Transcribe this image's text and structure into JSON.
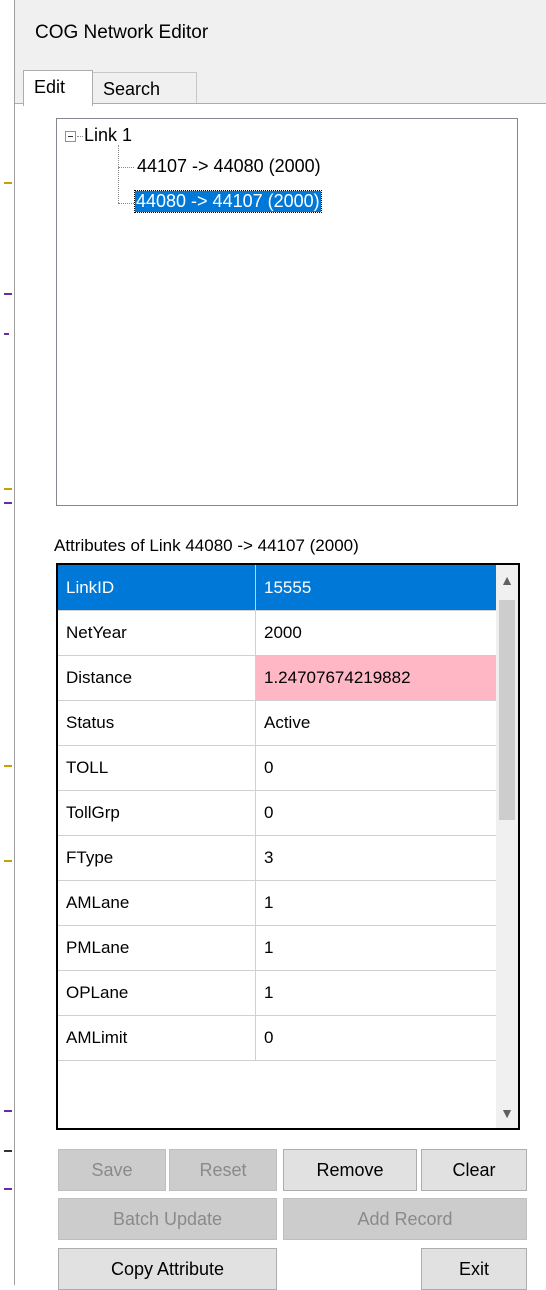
{
  "window": {
    "title": "COG Network Editor"
  },
  "tabs": [
    {
      "label": "Edit"
    },
    {
      "label": "Search"
    }
  ],
  "tree": {
    "root": {
      "label": "Link 1"
    },
    "children": [
      {
        "label": "44107 -> 44080 (2000)"
      },
      {
        "label": "44080 -> 44107 (2000)"
      }
    ]
  },
  "attributes": {
    "caption": "Attributes of Link 44080 -> 44107 (2000)",
    "rows": [
      {
        "name": "LinkID",
        "value": "15555"
      },
      {
        "name": "NetYear",
        "value": "2000"
      },
      {
        "name": "Distance",
        "value": "1.24707674219882"
      },
      {
        "name": "Status",
        "value": "Active"
      },
      {
        "name": "TOLL",
        "value": "0"
      },
      {
        "name": "TollGrp",
        "value": "0"
      },
      {
        "name": "FType",
        "value": "3"
      },
      {
        "name": "AMLane",
        "value": "1"
      },
      {
        "name": "PMLane",
        "value": "1"
      },
      {
        "name": "OPLane",
        "value": "1"
      },
      {
        "name": "AMLimit",
        "value": "0"
      }
    ]
  },
  "buttons": {
    "save": "Save",
    "reset": "Reset",
    "remove": "Remove",
    "clear": "Clear",
    "batch_update": "Batch Update",
    "add_record": "Add Record",
    "copy_attribute": "Copy Attribute",
    "exit": "Exit"
  },
  "colors": {
    "selection": "#0078d7",
    "invalid_value": "#ffb7c5"
  }
}
